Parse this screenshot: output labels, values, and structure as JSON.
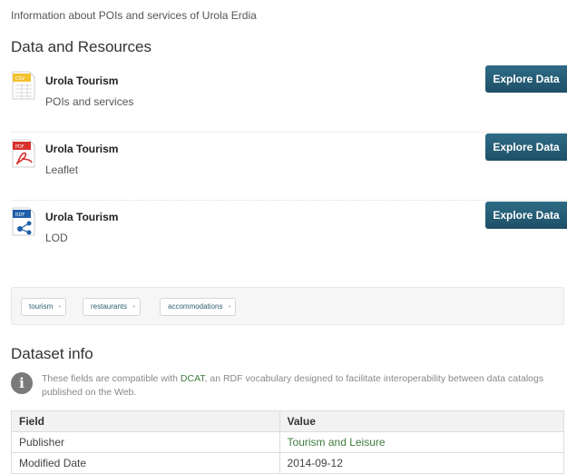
{
  "intro": "Information about POIs and services of Urola Erdia",
  "resources_section": {
    "title": "Data and Resources",
    "items": [
      {
        "name": "Urola Tourism",
        "description": "POIs and services",
        "format": "CSV",
        "button": "Explore Data",
        "color": "#f2c230"
      },
      {
        "name": "Urola Tourism",
        "description": "Leaflet",
        "format": "PDF",
        "button": "Explore Data",
        "color": "#d9302c"
      },
      {
        "name": "Urola Tourism",
        "description": "LOD",
        "format": "RDF",
        "button": "Explore Data",
        "color": "#1f5fa8"
      }
    ]
  },
  "tags": [
    "tourism",
    "restaurants",
    "accommodations"
  ],
  "dataset_info": {
    "title": "Dataset info",
    "note_before": "These fields are compatible with ",
    "note_link": "DCAT",
    "note_after": ", an RDF vocabulary designed to facilitate interoperability between data catalogs published on the Web.",
    "headers": {
      "field": "Field",
      "value": "Value"
    },
    "rows": [
      {
        "field": "Publisher",
        "value": "Tourism and Leisure"
      },
      {
        "field": "Modified Date",
        "value": "2014-09-12"
      }
    ]
  },
  "colors": {
    "button": "#1e5068",
    "link": "#3f7d3f",
    "tag_text": "#2f5e72"
  }
}
